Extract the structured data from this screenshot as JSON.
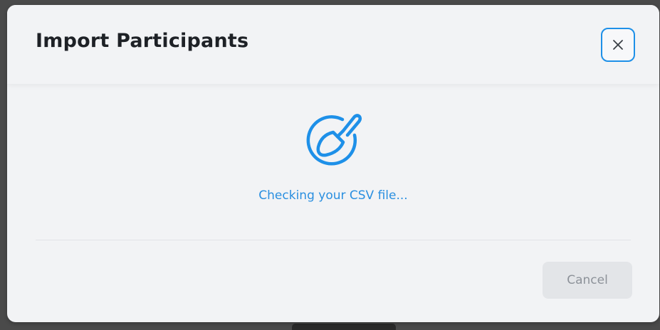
{
  "modal": {
    "title": "Import Participants",
    "status_text": "Checking your CSV file...",
    "cancel_label": "Cancel",
    "close_icon": "close-icon",
    "status_icon": "shovel-icon"
  },
  "colors": {
    "accent": "#1e90e8",
    "status_text": "#2a8fe0",
    "title": "#1e2126",
    "disabled_button_bg": "#e3e5e8",
    "disabled_button_text": "#8d9299"
  }
}
